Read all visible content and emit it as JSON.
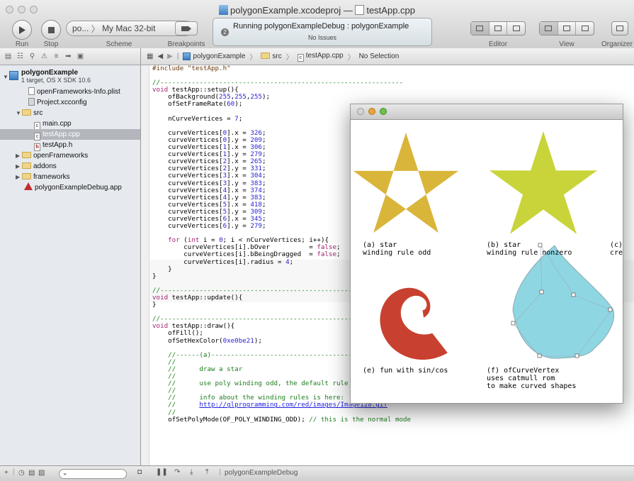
{
  "window": {
    "title": "polygonExample.xcodeproj",
    "separator": "—",
    "file": "testApp.cpp"
  },
  "toolbar": {
    "run_label": "Run",
    "stop_label": "Stop",
    "scheme_target": "po...",
    "scheme_sep": "〉",
    "scheme_destination": "My Mac 32-bit",
    "scheme_label": "Scheme",
    "breakpoints_label": "Breakpoints",
    "activity_main": "Running polygonExampleDebug : polygonExample",
    "activity_sub": "No Issues",
    "activity_badge": "2",
    "editor_label": "Editor",
    "view_label": "View",
    "organizer_label": "Organizer"
  },
  "navigator": {
    "items": [
      {
        "name": "polygonExample",
        "detail": "1 target, OS X SDK 10.6"
      },
      {
        "name": "openFrameworks-Info.plist"
      },
      {
        "name": "Project.xcconfig"
      },
      {
        "name": "src"
      },
      {
        "name": "main.cpp"
      },
      {
        "name": "testApp.cpp"
      },
      {
        "name": "testApp.h"
      },
      {
        "name": "openFrameworks"
      },
      {
        "name": "addons"
      },
      {
        "name": "frameworks"
      },
      {
        "name": "polygonExampleDebug.app"
      }
    ]
  },
  "jumpbar": {
    "crumbs": [
      "polygonExample",
      "src",
      "testApp.cpp",
      "No Selection"
    ]
  },
  "code_lines": [
    "#include \"testApp.h\"",
    "",
    "//--------------------------------------------------------------",
    "void testApp::setup(){",
    "    ofBackground(255,255,255);",
    "    ofSetFrameRate(60);",
    "",
    "    nCurveVertices = 7;",
    "",
    "    curveVertices[0].x = 326;",
    "    curveVertices[0].y = 209;",
    "    curveVertices[1].x = 306;",
    "    curveVertices[1].y = 279;",
    "    curveVertices[2].x = 265;",
    "    curveVertices[2].y = 331;",
    "    curveVertices[3].x = 304;",
    "    curveVertices[3].y = 383;",
    "    curveVertices[4].x = 374;",
    "    curveVertices[4].y = 383;",
    "    curveVertices[5].x = 418;",
    "    curveVertices[5].y = 309;",
    "    curveVertices[6].x = 345;",
    "    curveVertices[6].y = 279;",
    "",
    "    for (int i = 0; i < nCurveVertices; i++){",
    "        curveVertices[i].bOver          = false;",
    "        curveVertices[i].bBeingDragged  = false;",
    "        curveVertices[i].radius = 4;",
    "    }",
    "}",
    "",
    "//--------------------------------------------------------------",
    "void testApp::update(){",
    "}",
    "",
    "//--------------------------------------------------------------",
    "void testApp::draw(){",
    "    ofFill();",
    "    ofSetHexColor(0xe0be21);",
    "",
    "    //------(a)--------------------------------------",
    "    //",
    "    //      draw a star",
    "    //",
    "    //      use poly winding odd, the default rule",
    "    //",
    "    //      info about the winding rules is here:",
    "    //      http://glprogramming.com/red/images/Image128.gif",
    "    //",
    "    ofSetPolyMode(OF_POLY_WINDING_ODD); // this is the normal mode"
  ],
  "app_window": {
    "captions": {
      "a1": "(a) star",
      "a2": "winding rule odd",
      "b1": "(b) star",
      "b2": "winding rule nonzero",
      "c1": "(c)",
      "c2": "cre",
      "e1": "(e) fun with sin/cos",
      "f1": "(f) ofCurveVertex",
      "f2": "uses catmull rom",
      "f3": "to make curved shapes"
    },
    "colors": {
      "star_a": "#d9b53a",
      "star_b": "#c9d43a",
      "spiral": "#c8402f",
      "blob": "#8fd6e3"
    }
  },
  "debugbar": {
    "target": "polygonExampleDebug"
  }
}
